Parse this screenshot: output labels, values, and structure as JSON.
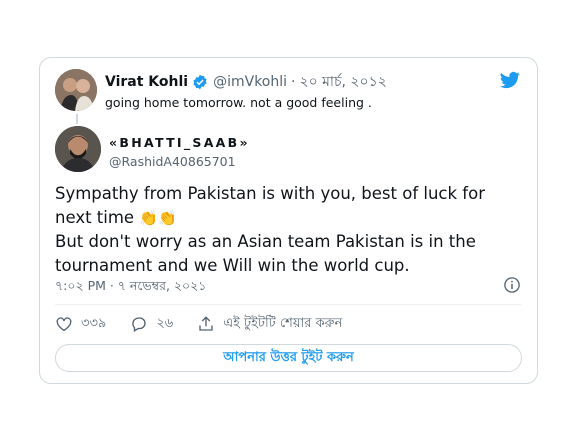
{
  "quoted": {
    "name": "Virat Kohli",
    "handle": "@imVkohli",
    "separator": "·",
    "date": "২০ মার্চ, ২০১২",
    "text": "going home tomorrow. not a good feeling ."
  },
  "main": {
    "name": "«BHATTI_SAAB»",
    "handle": "@RashidA40865701",
    "line1": "Sympathy from Pakistan is with you, best of luck for next time",
    "emoji": "👏👏",
    "line2": "But don't worry as an Asian team Pakistan is in the tournament and we Will win the world cup.",
    "timestamp": "৭:০২ PM · ৭ নভেম্বর, ২০২১"
  },
  "actions": {
    "likes": "৩৩৯",
    "replies": "২৬",
    "share_label": "এই টুইটটি শেয়ার করুন"
  },
  "reply_button": "আপনার উত্তর টুইট করুন",
  "colors": {
    "accent": "#1d9bf0",
    "muted": "#536471",
    "border": "#cfd9de"
  },
  "icons": [
    "verified-badge-icon",
    "twitter-bird-icon",
    "info-icon",
    "heart-icon",
    "reply-icon",
    "share-icon"
  ]
}
